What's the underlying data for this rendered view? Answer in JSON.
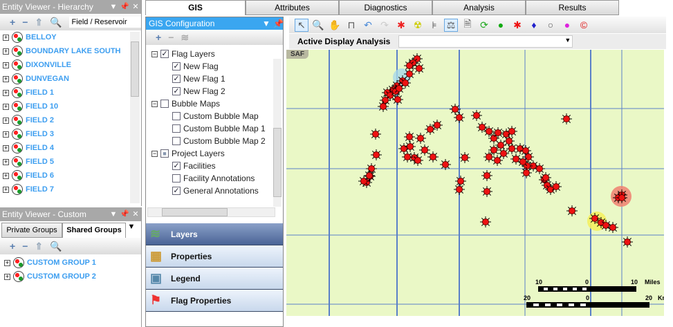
{
  "hierarchy_panel": {
    "title": "Entity Viewer - Hierarchy",
    "filter": "Field / Reservoir",
    "items": [
      "BELLOY",
      "BOUNDARY LAKE SOUTH",
      "DIXONVILLE",
      "DUNVEGAN",
      "FIELD 1",
      "FIELD 10",
      "FIELD 2",
      "FIELD 3",
      "FIELD 4",
      "FIELD 5",
      "FIELD 6",
      "FIELD 7"
    ]
  },
  "custom_panel": {
    "title": "Entity Viewer - Custom",
    "tabs": [
      "Private Groups",
      "Shared Groups"
    ],
    "items": [
      "CUSTOM GROUP 1",
      "CUSTOM GROUP 2"
    ]
  },
  "main_tabs": [
    "GIS",
    "Attributes",
    "Diagnostics",
    "Analysis",
    "Results"
  ],
  "gis_config": {
    "title": "GIS Configuration",
    "tree": [
      {
        "label": "Flag Layers",
        "checked": true,
        "level": 0
      },
      {
        "label": "New Flag",
        "checked": true,
        "level": 1
      },
      {
        "label": "New Flag 1",
        "checked": true,
        "level": 1
      },
      {
        "label": "New Flag 2",
        "checked": true,
        "level": 1
      },
      {
        "label": "Bubble Maps",
        "checked": false,
        "level": 0
      },
      {
        "label": "Custom Bubble Map",
        "checked": false,
        "level": 1
      },
      {
        "label": "Custom Bubble Map 1",
        "checked": false,
        "level": 1
      },
      {
        "label": "Custom Bubble Map 2",
        "checked": false,
        "level": 1
      },
      {
        "label": "Project Layers",
        "checked": "partial",
        "level": 0
      },
      {
        "label": "Facilities",
        "checked": true,
        "level": 1
      },
      {
        "label": "Facility Annotations",
        "checked": false,
        "level": 1
      },
      {
        "label": "General Annotations",
        "checked": true,
        "level": 1
      }
    ],
    "sections": [
      "Layers",
      "Properties",
      "Legend",
      "Flag Properties"
    ]
  },
  "map": {
    "display_label": "Active Display Analysis",
    "display_value": "",
    "corner_label": "SAF",
    "scale_miles": {
      "left": "10",
      "mid": "0",
      "right": "10",
      "unit": "Miles"
    },
    "scale_km": {
      "left": "20",
      "mid": "0",
      "right": "20",
      "unit": "Km"
    }
  },
  "colors": {
    "accent": "#3c9ef0",
    "map_bg": "#eaf8c6",
    "grid": "#5a80c8",
    "marker": "#ee1111"
  }
}
